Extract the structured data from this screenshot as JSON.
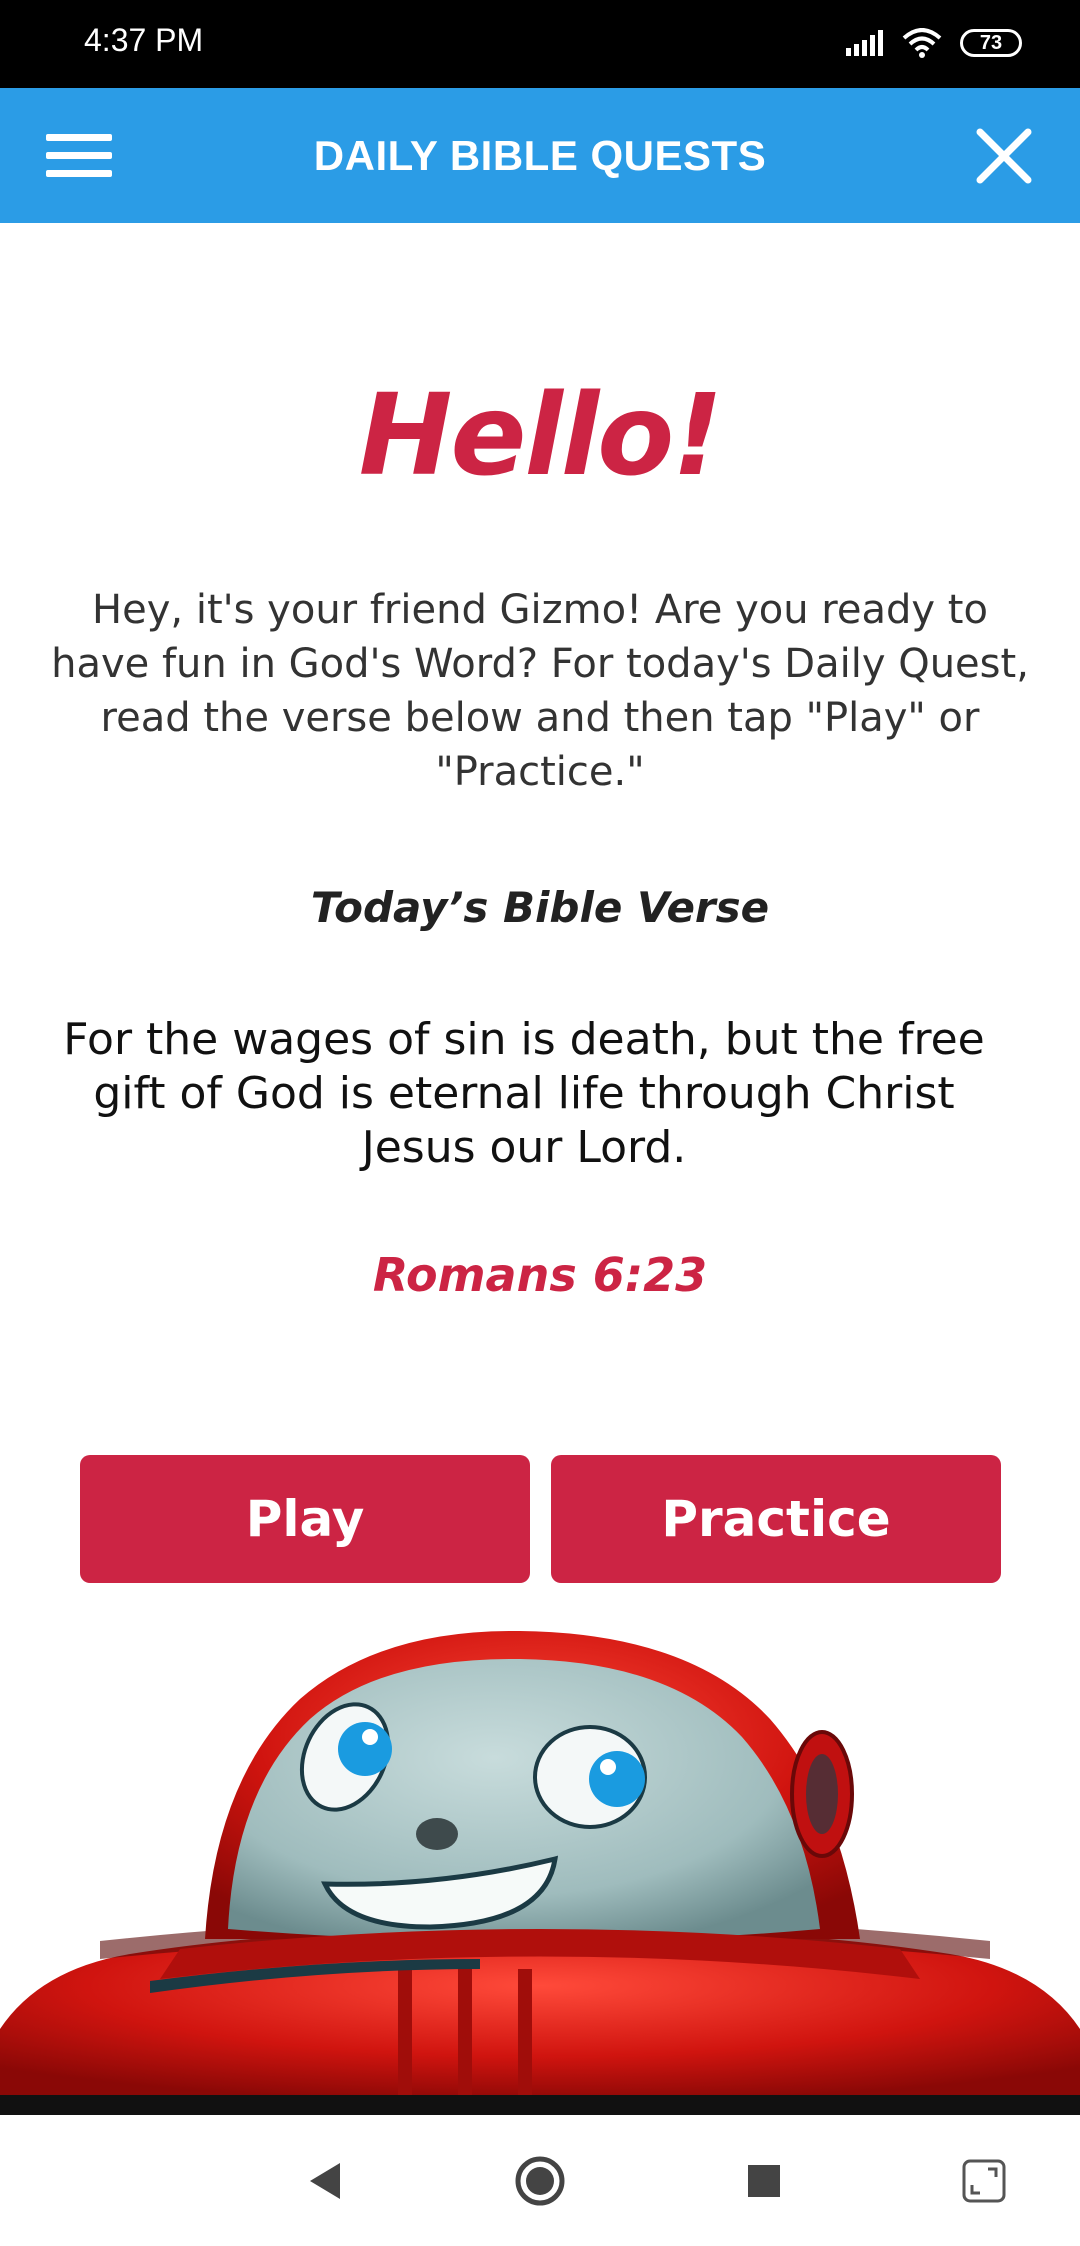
{
  "status_bar": {
    "time": "4:37 PM",
    "battery": "73",
    "icons": [
      "signal-icon",
      "wifi-icon",
      "battery-icon"
    ]
  },
  "app_bar": {
    "title": "DAILY BIBLE QUESTS",
    "menu_icon": "hamburger-menu-icon",
    "close_icon": "close-icon",
    "color": "#2b9ce6"
  },
  "main": {
    "greeting": "Hello!",
    "intro": "Hey, it's your friend Gizmo! Are you ready to have fun in God's Word? For today's Daily Quest, read the verse below and then tap \"Play\" or \"Practice.\"",
    "verse_heading": "Today’s Bible Verse",
    "verse_text": "For the wages of sin is death, but the free gift of God is eternal life through Christ Jesus our Lord.",
    "verse_reference": "Romans 6:23",
    "accent_color": "#cc2444",
    "buttons": {
      "play": "Play",
      "practice": "Practice"
    },
    "mascot": "gizmo-robot-image"
  },
  "nav_bar": {
    "icons": [
      "back-icon",
      "home-icon",
      "recents-icon",
      "expand-icon"
    ]
  }
}
